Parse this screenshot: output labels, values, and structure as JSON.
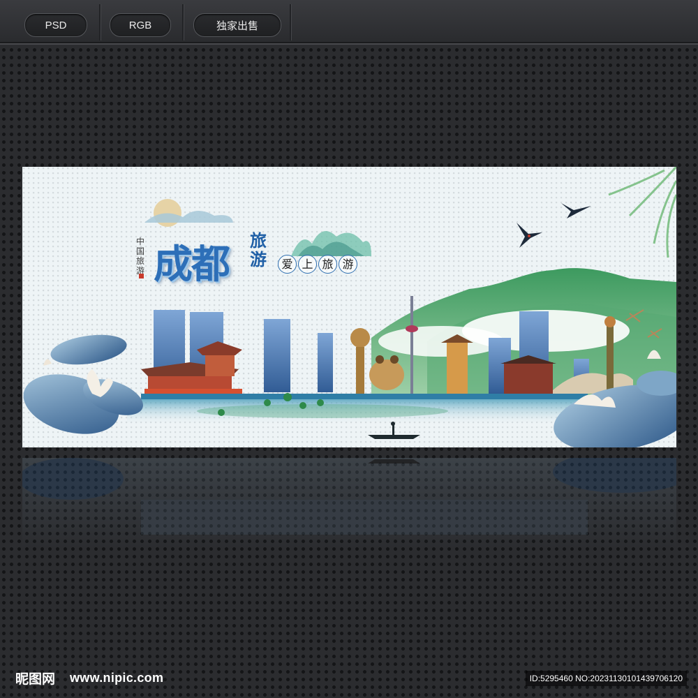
{
  "tags": [
    "PSD",
    "RGB",
    "独家出售"
  ],
  "poster": {
    "title_main": "成都",
    "title_side": "旅游",
    "title_vertical": "中国旅游",
    "slogan_chars": [
      "爱",
      "上",
      "旅",
      "游"
    ]
  },
  "footer": {
    "logo": "昵图网",
    "url": "www.nipic.com",
    "id_text": "ID:5295460 NO:20231130101439706120"
  },
  "colors": {
    "background": "#2b2c2f",
    "poster_bg": "#eef4f6",
    "title_blue": "#2d6fb8",
    "mountain_green": "#3f9a62",
    "lotus_blue": "#3e6d9e"
  },
  "icons": [
    "swallow-icon",
    "lotus-leaf-icon",
    "lotus-flower-icon",
    "dragonfly-icon",
    "boat-icon"
  ]
}
